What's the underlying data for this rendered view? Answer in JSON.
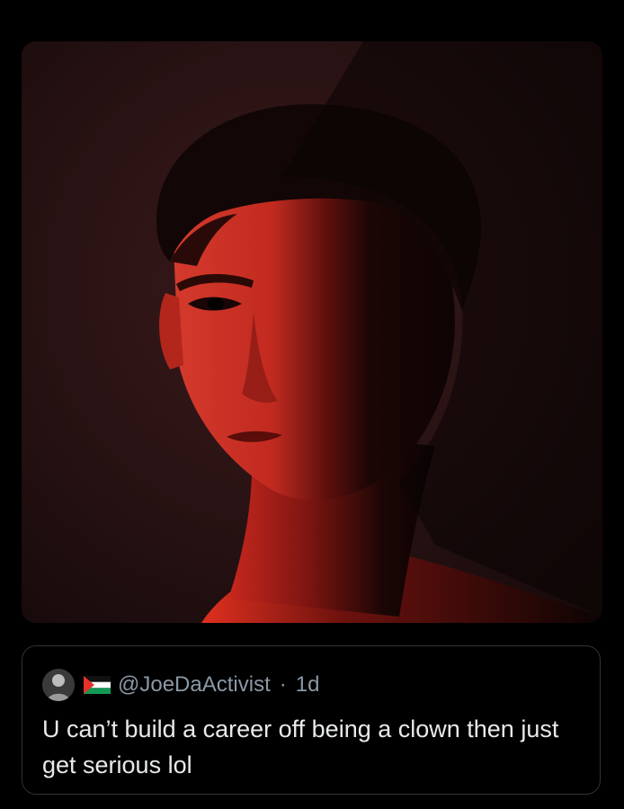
{
  "media": {
    "image_alt": "portrait photo"
  },
  "quote": {
    "handle": "@JoeDaActivist",
    "separator": "·",
    "time": "1d",
    "text": "U can’t build a career off being a clown then just get serious lol"
  },
  "colors": {
    "background": "#000000",
    "border": "#2f3336",
    "secondary_text": "#8b98a5",
    "primary_text": "#e7e9ea",
    "red_light": "#d32a1f"
  },
  "icons": {
    "flag": "palestine-flag-icon"
  }
}
